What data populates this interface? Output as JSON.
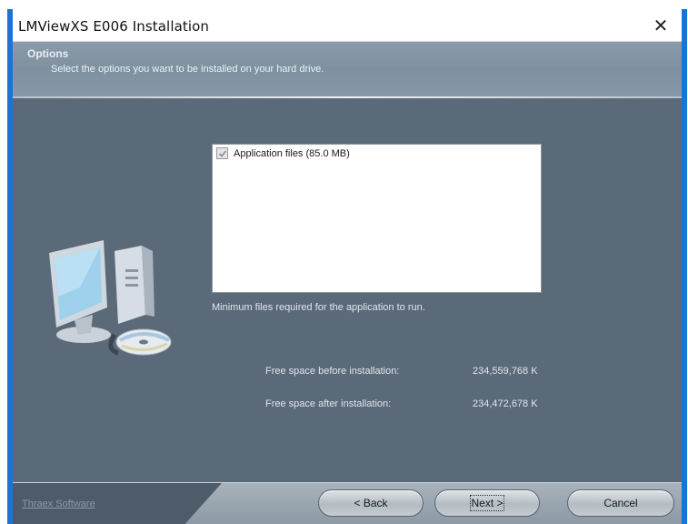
{
  "window": {
    "title": "LMViewXS E006 Installation",
    "close_glyph": "✕"
  },
  "header": {
    "title": "Options",
    "subtitle": "Select the options you want to be installed on your hard drive."
  },
  "options": [
    {
      "label": "Application files (85.0 MB)",
      "checked": true,
      "enabled": false
    }
  ],
  "description": "Minimum files required for the application to run.",
  "disk_space": {
    "before_label": "Free space before installation:",
    "before_value": "234,559,768 K",
    "after_label": "Free space after installation:",
    "after_value": "234,472,678 K"
  },
  "footer": {
    "brand": "Thraex Software",
    "back_label": "< Back",
    "next_label": "Next >",
    "cancel_label": "Cancel"
  },
  "colors": {
    "window_border": "#1a74d8",
    "body_bg": "#5b6a79",
    "header_bg": "#8a9aa8"
  }
}
